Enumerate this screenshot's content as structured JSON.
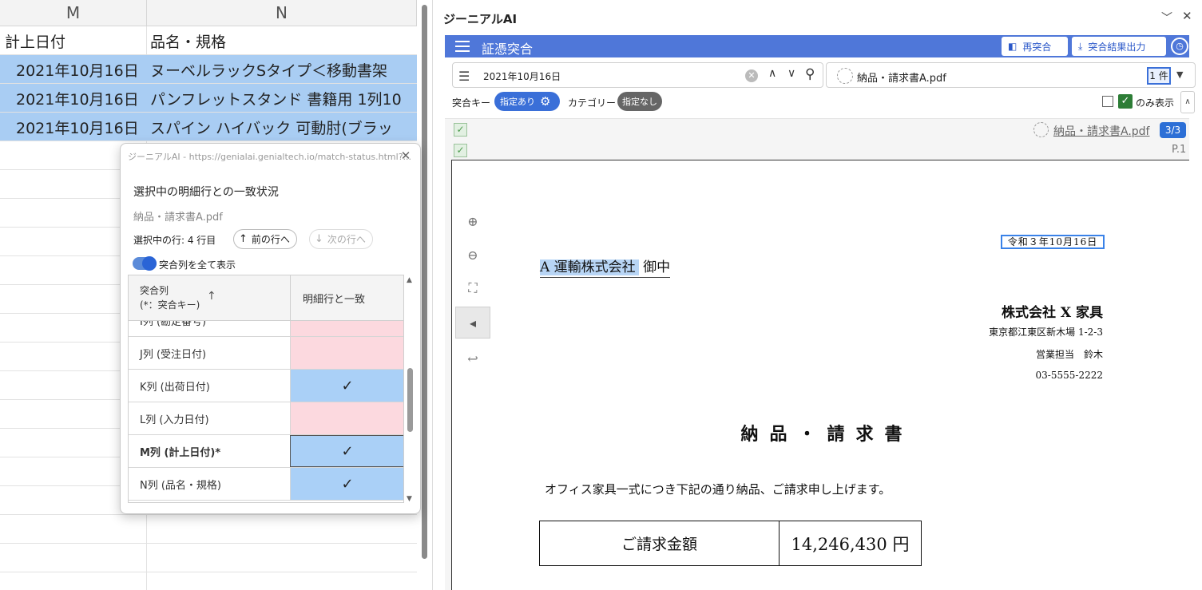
{
  "sheet": {
    "col_m": "M",
    "col_n": "N",
    "header_m": "計上日付",
    "header_n": "品名・規格",
    "rows": [
      {
        "date": "2021年10月16日",
        "name": "ヌーベルラックSタイプ＜移動書架"
      },
      {
        "date": "2021年10月16日",
        "name": "パンフレットスタンド 書籍用 1列10"
      },
      {
        "date": "2021年10月16日",
        "name": "スパイン ハイバック 可動肘(ブラッ"
      }
    ]
  },
  "popup": {
    "title": "ジーニアルAI - https://genialai.genialtech.io/match-status.html?...",
    "heading": "選択中の明細行との一致状況",
    "file": "納品・請求書A.pdf",
    "selected_row": "選択中の行: 4 行目",
    "prev_label": "前の行へ",
    "next_label": "次の行へ",
    "toggle_label": "突合列を全て表示",
    "col_header_1": "突合列",
    "col_header_1_sub": "(*：突合キー)",
    "col_header_2": "明細行と一致",
    "check_mark": "✓",
    "rows": [
      {
        "label": "I列 (勘定番号)",
        "match": false
      },
      {
        "label": "J列 (受注日付)",
        "match": false
      },
      {
        "label": "K列 (出荷日付)",
        "match": true
      },
      {
        "label": "L列 (入力日付)",
        "match": false
      },
      {
        "label": "M列 (計上日付)*",
        "match": true
      },
      {
        "label": "N列 (品名・規格)",
        "match": true
      }
    ]
  },
  "panel": {
    "title": "ジーニアルAI",
    "bar_title": "証憑突合",
    "recompare_label": "再突合",
    "export_label": "突合結果出力",
    "search_value": "2021年10月16日",
    "file_name": "納品・請求書A.pdf",
    "count": "1 件",
    "key_label": "突合キー",
    "key_pill": "指定あり",
    "category_label": "カテゴリー",
    "category_pill": "指定なし",
    "only_label": "のみ表示"
  },
  "document": {
    "file": "納品・請求書A.pdf",
    "pages": "3/3",
    "page_num": "P.1",
    "date": "令和３年10月16日",
    "to_company": "A 運輸株式会社",
    "to_suffix": "御中",
    "company": "株式会社 X 家具",
    "address": "東京都江東区新木場 1-2-3",
    "rep": "営業担当　鈴木",
    "tel": "03-5555-2222",
    "doc_title": "納品・請求書",
    "intro": "オフィス家具一式につき下記の通り納品、ご請求申し上げます。",
    "amount_label": "ご請求金額",
    "amount_value": "14,246,430 円"
  },
  "colors": {
    "accent": "#4f77d9",
    "selection": "#a9cdf3",
    "mismatch": "#fcd9df",
    "match": "#aad0f7"
  }
}
